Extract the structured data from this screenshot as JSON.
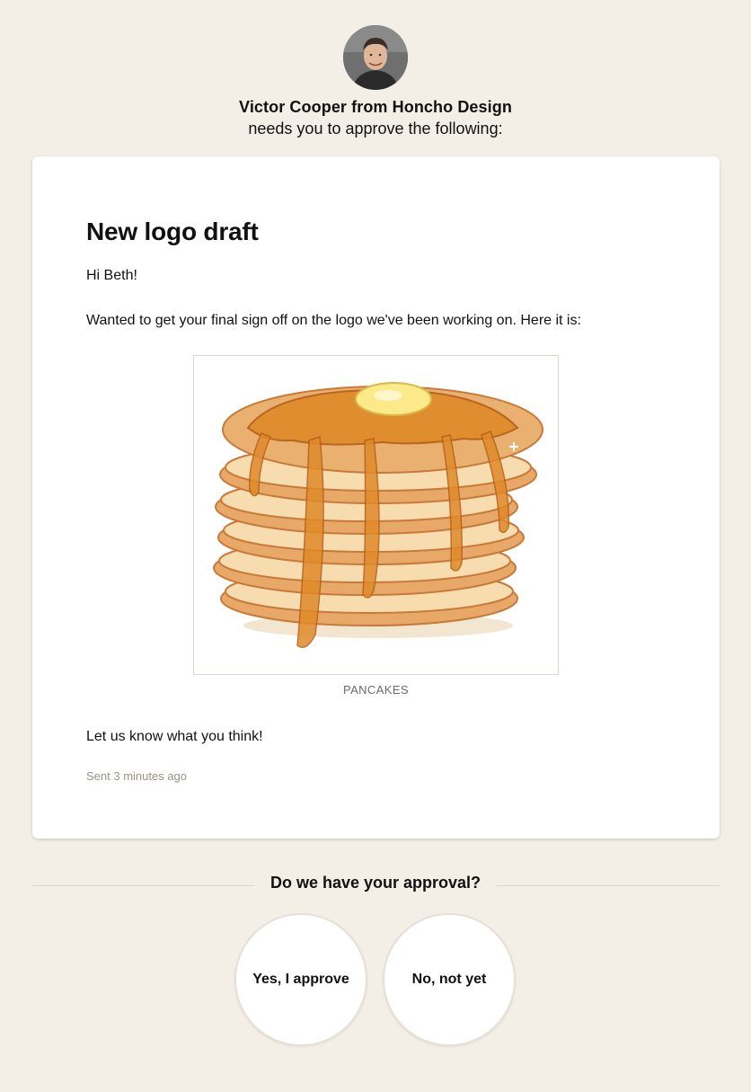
{
  "header": {
    "sender": "Victor Cooper from Honcho Design",
    "request": "needs you to approve the following:",
    "avatar_icon": "avatar-photo"
  },
  "card": {
    "title": "New logo draft",
    "greeting": "Hi Beth!",
    "intro": "Wanted to get your final sign off on the logo we've been working on. Here it is:",
    "image": {
      "icon": "pancakes-illustration",
      "caption": "PANCAKES"
    },
    "closing": "Let us know what you think!",
    "sent": "Sent 3 minutes ago"
  },
  "approval": {
    "question": "Do we have your approval?",
    "approve_label": "Yes, I approve",
    "reject_label": "No, not yet"
  },
  "colors": {
    "background": "#f4efe6",
    "card": "#ffffff",
    "syrup": "#e08a2a",
    "pancake": "#f1c98c",
    "butter": "#fbe98a"
  }
}
